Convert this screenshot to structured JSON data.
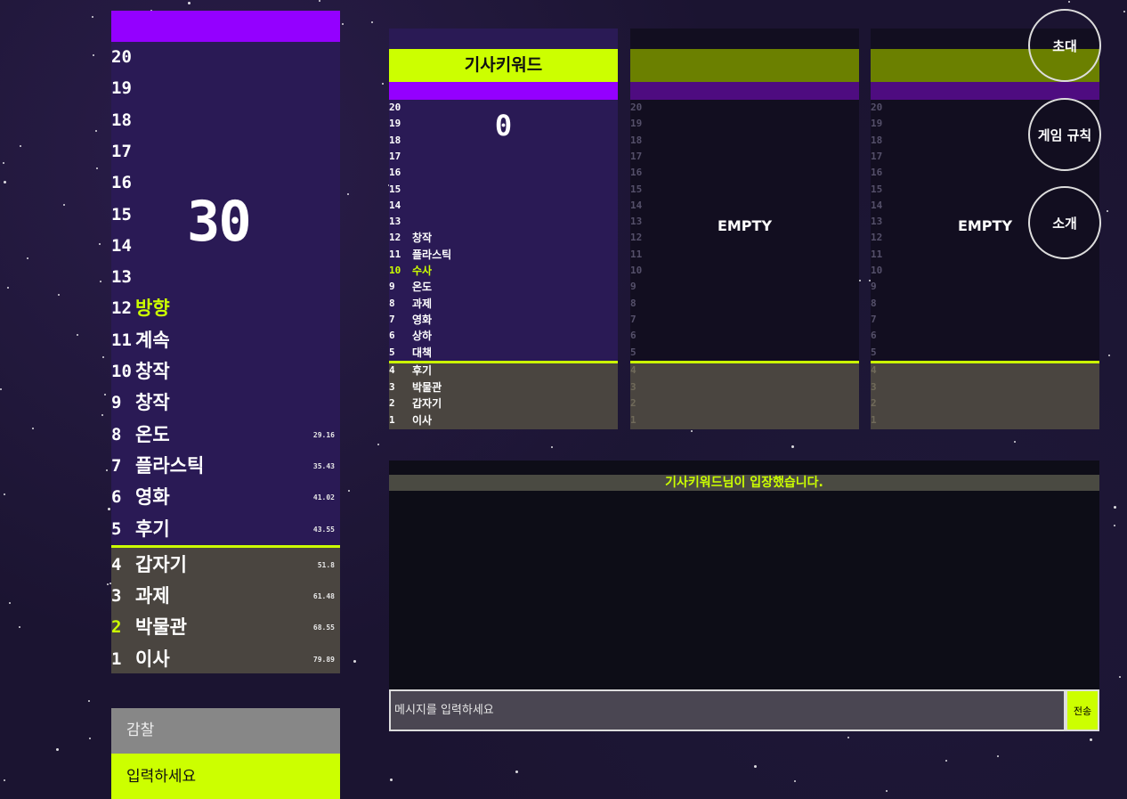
{
  "left_board": {
    "countdown": "30",
    "rows": [
      {
        "num": "20",
        "word": "",
        "time": ""
      },
      {
        "num": "19",
        "word": "",
        "time": ""
      },
      {
        "num": "18",
        "word": "",
        "time": ""
      },
      {
        "num": "17",
        "word": "",
        "time": ""
      },
      {
        "num": "16",
        "word": "",
        "time": ""
      },
      {
        "num": "15",
        "word": "",
        "time": ""
      },
      {
        "num": "14",
        "word": "",
        "time": ""
      },
      {
        "num": "13",
        "word": "",
        "time": ""
      },
      {
        "num": "12",
        "word": "방향",
        "time": "",
        "highlight": true
      },
      {
        "num": "11",
        "word": "계속",
        "time": ""
      },
      {
        "num": "10",
        "word": "창작",
        "time": ""
      },
      {
        "num": "9",
        "word": "창작",
        "time": ""
      },
      {
        "num": "8",
        "word": "온도",
        "time": "29.16"
      },
      {
        "num": "7",
        "word": "플라스틱",
        "time": "35.43"
      },
      {
        "num": "6",
        "word": "영화",
        "time": "41.02"
      },
      {
        "num": "5",
        "word": "후기",
        "time": "43.55"
      },
      {
        "num": "4",
        "word": "갑자기",
        "time": "51.8"
      },
      {
        "num": "3",
        "word": "과제",
        "time": "61.48"
      },
      {
        "num": "2",
        "word": "박물관",
        "time": "68.55",
        "num_highlight": true
      },
      {
        "num": "1",
        "word": "이사",
        "time": "79.89"
      }
    ]
  },
  "guess_box": {
    "label": "감찰",
    "placeholder": "입력하세요"
  },
  "players": [
    {
      "name": "기사키워드",
      "score": "0",
      "status": "",
      "rows": [
        {
          "num": "20",
          "word": ""
        },
        {
          "num": "19",
          "word": ""
        },
        {
          "num": "18",
          "word": ""
        },
        {
          "num": "17",
          "word": ""
        },
        {
          "num": "16",
          "word": ""
        },
        {
          "num": "15",
          "word": ""
        },
        {
          "num": "14",
          "word": ""
        },
        {
          "num": "13",
          "word": ""
        },
        {
          "num": "12",
          "word": "창작"
        },
        {
          "num": "11",
          "word": "플라스틱"
        },
        {
          "num": "10",
          "word": "수사",
          "highlight": true
        },
        {
          "num": "9",
          "word": "온도"
        },
        {
          "num": "8",
          "word": "과제"
        },
        {
          "num": "7",
          "word": "영화"
        },
        {
          "num": "6",
          "word": "상하"
        },
        {
          "num": "5",
          "word": "대책"
        },
        {
          "num": "4",
          "word": "후기"
        },
        {
          "num": "3",
          "word": "박물관"
        },
        {
          "num": "2",
          "word": "갑자기"
        },
        {
          "num": "1",
          "word": "이사"
        }
      ]
    },
    {
      "name": "",
      "score": "",
      "status": "EMPTY",
      "rows": [
        {
          "num": "20",
          "word": ""
        },
        {
          "num": "19",
          "word": ""
        },
        {
          "num": "18",
          "word": ""
        },
        {
          "num": "17",
          "word": ""
        },
        {
          "num": "16",
          "word": ""
        },
        {
          "num": "15",
          "word": ""
        },
        {
          "num": "14",
          "word": ""
        },
        {
          "num": "13",
          "word": ""
        },
        {
          "num": "12",
          "word": ""
        },
        {
          "num": "11",
          "word": ""
        },
        {
          "num": "10",
          "word": ""
        },
        {
          "num": "9",
          "word": ""
        },
        {
          "num": "8",
          "word": ""
        },
        {
          "num": "7",
          "word": ""
        },
        {
          "num": "6",
          "word": ""
        },
        {
          "num": "5",
          "word": ""
        },
        {
          "num": "4",
          "word": ""
        },
        {
          "num": "3",
          "word": ""
        },
        {
          "num": "2",
          "word": ""
        },
        {
          "num": "1",
          "word": ""
        }
      ]
    },
    {
      "name": "",
      "score": "",
      "status": "EMPTY",
      "rows": [
        {
          "num": "20",
          "word": ""
        },
        {
          "num": "19",
          "word": ""
        },
        {
          "num": "18",
          "word": ""
        },
        {
          "num": "17",
          "word": ""
        },
        {
          "num": "16",
          "word": ""
        },
        {
          "num": "15",
          "word": ""
        },
        {
          "num": "14",
          "word": ""
        },
        {
          "num": "13",
          "word": ""
        },
        {
          "num": "12",
          "word": ""
        },
        {
          "num": "11",
          "word": ""
        },
        {
          "num": "10",
          "word": ""
        },
        {
          "num": "9",
          "word": ""
        },
        {
          "num": "8",
          "word": ""
        },
        {
          "num": "7",
          "word": ""
        },
        {
          "num": "6",
          "word": ""
        },
        {
          "num": "5",
          "word": ""
        },
        {
          "num": "4",
          "word": ""
        },
        {
          "num": "3",
          "word": ""
        },
        {
          "num": "2",
          "word": ""
        },
        {
          "num": "1",
          "word": ""
        }
      ]
    }
  ],
  "chat": {
    "system_message": "기사키워드님이 입장했습니다.",
    "input_placeholder": "메시지를 입력하세요",
    "send_label": "전송"
  },
  "side_buttons": {
    "invite": "초대",
    "rules": "게임 규칙",
    "intro": "소개"
  },
  "colors": {
    "accent": "#ccff00",
    "purple": "#9400ff",
    "board": "#2a1a55",
    "low_zone": "#4a4540"
  }
}
